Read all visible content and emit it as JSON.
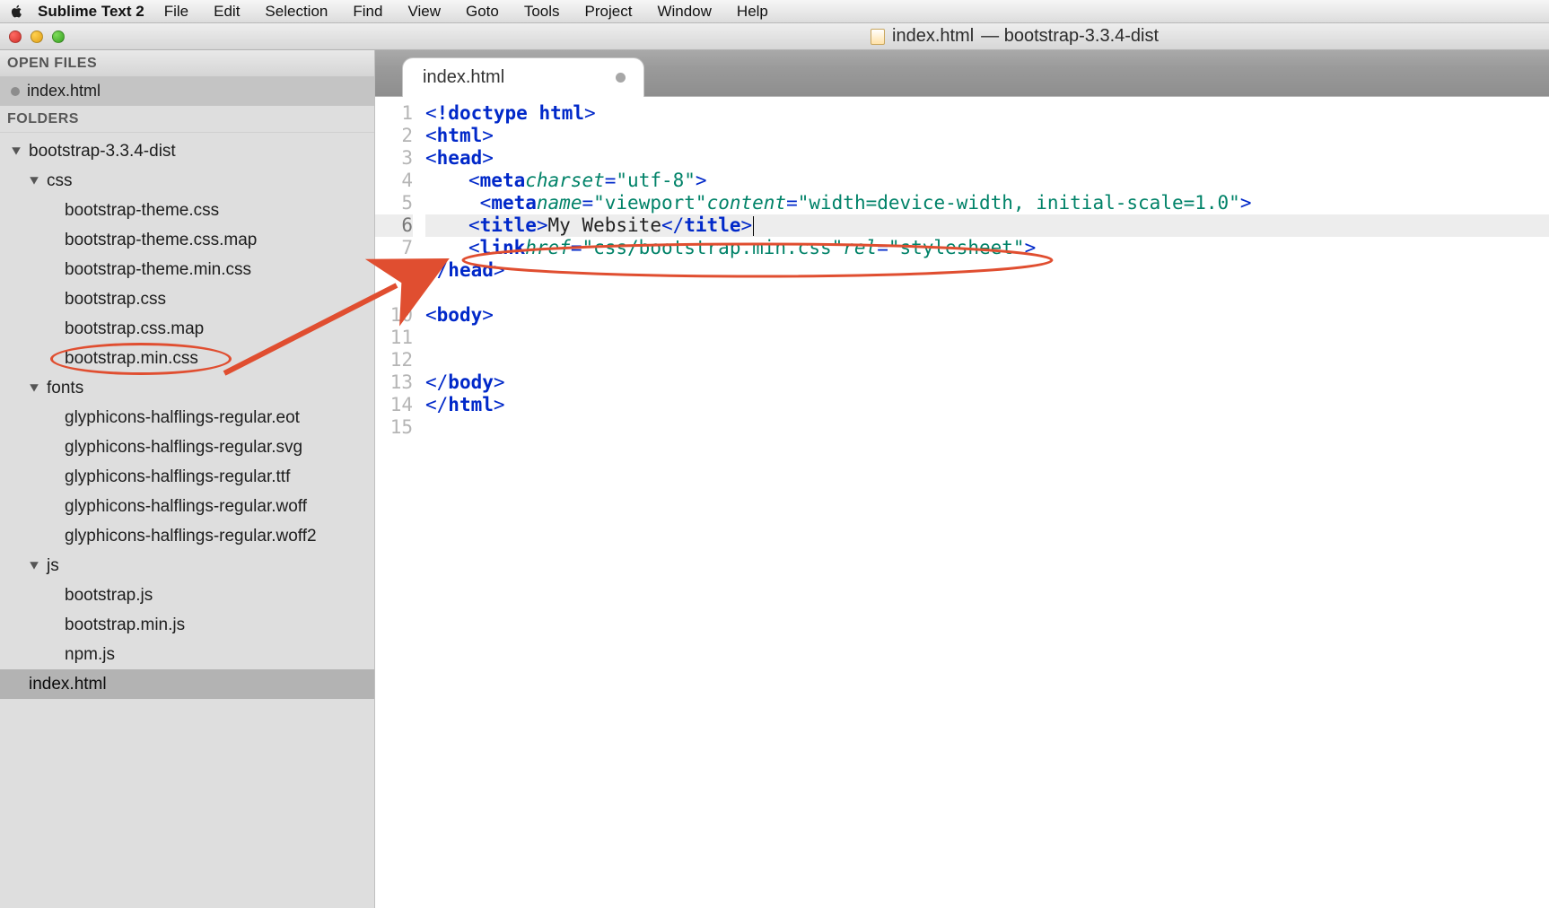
{
  "menubar": {
    "appname": "Sublime Text 2",
    "items": [
      "File",
      "Edit",
      "Selection",
      "Find",
      "View",
      "Goto",
      "Tools",
      "Project",
      "Window",
      "Help"
    ]
  },
  "window": {
    "title_file": "index.html",
    "title_rest": " — bootstrap-3.3.4-dist"
  },
  "sidebar": {
    "open_files_label": "OPEN FILES",
    "open_files": [
      "index.html"
    ],
    "folders_label": "FOLDERS",
    "tree": [
      {
        "label": "bootstrap-3.3.4-dist",
        "depth": 0,
        "folder": true,
        "open": true
      },
      {
        "label": "css",
        "depth": 1,
        "folder": true,
        "open": true
      },
      {
        "label": "bootstrap-theme.css",
        "depth": 2
      },
      {
        "label": "bootstrap-theme.css.map",
        "depth": 2
      },
      {
        "label": "bootstrap-theme.min.css",
        "depth": 2
      },
      {
        "label": "bootstrap.css",
        "depth": 2
      },
      {
        "label": "bootstrap.css.map",
        "depth": 2
      },
      {
        "label": "bootstrap.min.css",
        "depth": 2,
        "circled": true
      },
      {
        "label": "fonts",
        "depth": 1,
        "folder": true,
        "open": true
      },
      {
        "label": "glyphicons-halflings-regular.eot",
        "depth": 2
      },
      {
        "label": "glyphicons-halflings-regular.svg",
        "depth": 2
      },
      {
        "label": "glyphicons-halflings-regular.ttf",
        "depth": 2
      },
      {
        "label": "glyphicons-halflings-regular.woff",
        "depth": 2
      },
      {
        "label": "glyphicons-halflings-regular.woff2",
        "depth": 2
      },
      {
        "label": "js",
        "depth": 1,
        "folder": true,
        "open": true
      },
      {
        "label": "bootstrap.js",
        "depth": 2
      },
      {
        "label": "bootstrap.min.js",
        "depth": 2
      },
      {
        "label": "npm.js",
        "depth": 2
      },
      {
        "label": "index.html",
        "depth": 1,
        "selected": true
      }
    ]
  },
  "tabs": [
    {
      "label": "index.html",
      "dirty": true,
      "active": true
    }
  ],
  "code_lines": [
    "1",
    "2",
    "3",
    "4",
    "5",
    "6",
    "7",
    "8",
    "9",
    "10",
    "11",
    "12",
    "13",
    "14",
    "15"
  ],
  "code": {
    "l1_doctype": "<!doctype html>",
    "l2": "<html>",
    "l3": "<head>",
    "l4_tag": "meta",
    "l4_attr1": "charset",
    "l4_val1": "\"utf-8\"",
    "l5_tag": "meta",
    "l5_attr1": "name",
    "l5_val1": "\"viewport\"",
    "l5_attr2": "content",
    "l5_val2": "\"width=device-width, initial-scale=1.0\"",
    "l6_open": "<title>",
    "l6_text": "My Website",
    "l6_close": "</title>",
    "l7_tag": "link",
    "l7_attr1": "href",
    "l7_val1": "\"css/bootstrap.min.css\"",
    "l7_attr2": "rel",
    "l7_val2": "\"stylesheet\"",
    "l8": "</head>",
    "l10": "<body>",
    "l13": "</body>",
    "l14": "</html>"
  }
}
